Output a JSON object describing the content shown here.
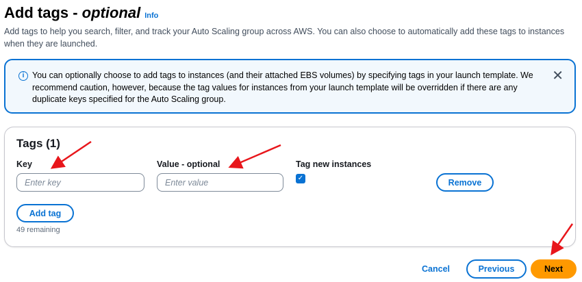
{
  "header": {
    "title": "Add tags - ",
    "title_italic": "optional",
    "info_link": "Info",
    "description": "Add tags to help you search, filter, and track your Auto Scaling group across AWS. You can also choose to automatically add these tags to instances when they are launched."
  },
  "alert": {
    "icon": "info-icon",
    "text": "You can optionally choose to add tags to instances (and their attached EBS volumes) by specifying tags in your launch template. We recommend caution, however, because the tag values for instances from your launch template will be overridden if there are any duplicate keys specified for the Auto Scaling group.",
    "close_icon": "close-icon"
  },
  "tags": {
    "title": "Tags (1)",
    "key_label": "Key",
    "value_label": "Value - optional",
    "tag_new_label": "Tag new instances",
    "key_placeholder": "Enter key",
    "value_placeholder": "Enter value",
    "key_value": "",
    "value_value": "",
    "tag_new_checked": true,
    "remove_label": "Remove",
    "add_tag_label": "Add tag",
    "remaining": "49 remaining"
  },
  "footer": {
    "cancel": "Cancel",
    "previous": "Previous",
    "next": "Next"
  },
  "colors": {
    "accent": "#0972d3",
    "primary": "#ff9900",
    "annotation": "#e8161b"
  }
}
